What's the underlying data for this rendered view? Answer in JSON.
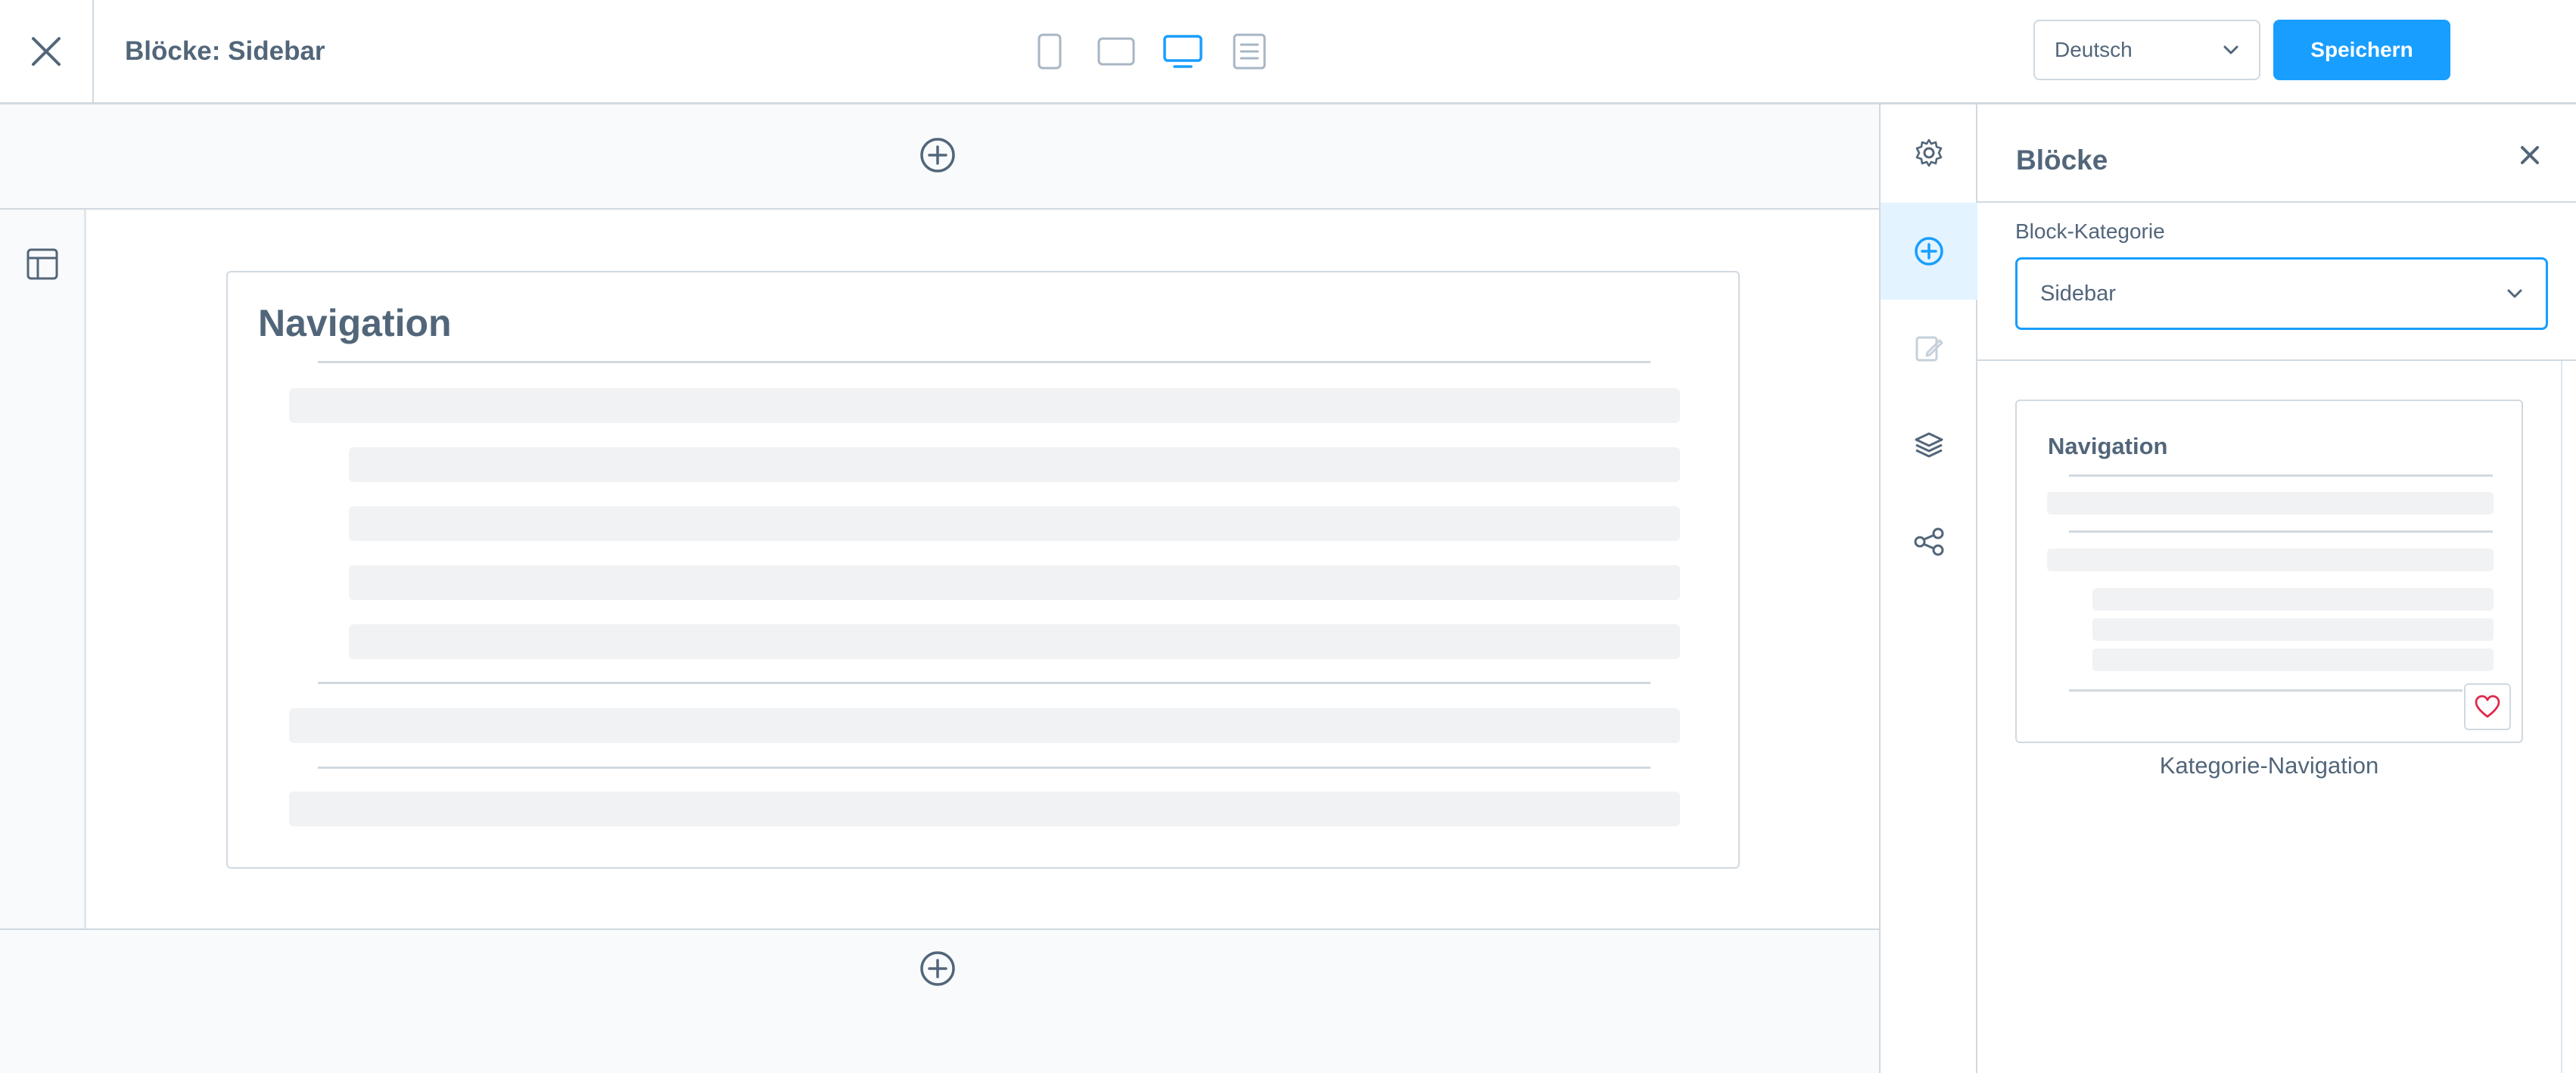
{
  "header": {
    "title": "Blöcke: Sidebar",
    "close_icon": "close-icon",
    "devices": [
      "mobile-icon",
      "tablet-icon",
      "desktop-icon",
      "list-view-icon"
    ],
    "active_device": "desktop-icon",
    "language_value": "Deutsch",
    "save_label": "Speichern"
  },
  "canvas": {
    "block": {
      "title": "Navigation"
    }
  },
  "rail": {
    "items": [
      "settings-icon",
      "add-block-icon",
      "edit-icon",
      "layers-icon",
      "share-icon"
    ],
    "active": "add-block-icon"
  },
  "panel": {
    "title": "Blöcke",
    "category_label": "Block-Kategorie",
    "category_value": "Sidebar",
    "card": {
      "title": "Navigation",
      "caption": "Kategorie-Navigation"
    }
  },
  "colors": {
    "accent": "#189eff",
    "text": "#52667a",
    "border": "#d1d9e0",
    "favorite": "#de294c"
  }
}
